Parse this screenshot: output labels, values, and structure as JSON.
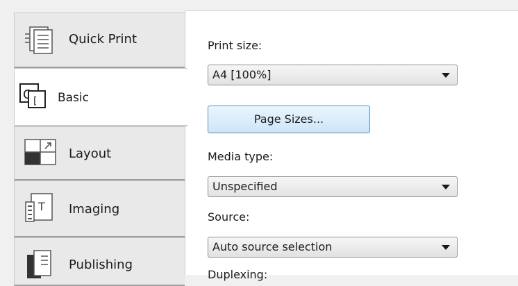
{
  "tabs": [
    {
      "label": "Quick Print",
      "icon": "quick-print-icon"
    },
    {
      "label": "Basic",
      "icon": "basic-icon",
      "active": true
    },
    {
      "label": "Layout",
      "icon": "layout-icon"
    },
    {
      "label": "Imaging",
      "icon": "imaging-icon"
    },
    {
      "label": "Publishing",
      "icon": "publishing-icon"
    }
  ],
  "fields": {
    "print_size_label": "Print size:",
    "print_size_value": "A4  [100%]",
    "page_sizes_button": "Page Sizes...",
    "media_type_label": "Media type:",
    "media_type_value": "Unspecified",
    "source_label": "Source:",
    "source_value": "Auto source selection",
    "cut_off_label": "Duplexing:"
  },
  "colors": {
    "panel_bg": "#ffffff",
    "button_accent": "#5e8fbe"
  }
}
